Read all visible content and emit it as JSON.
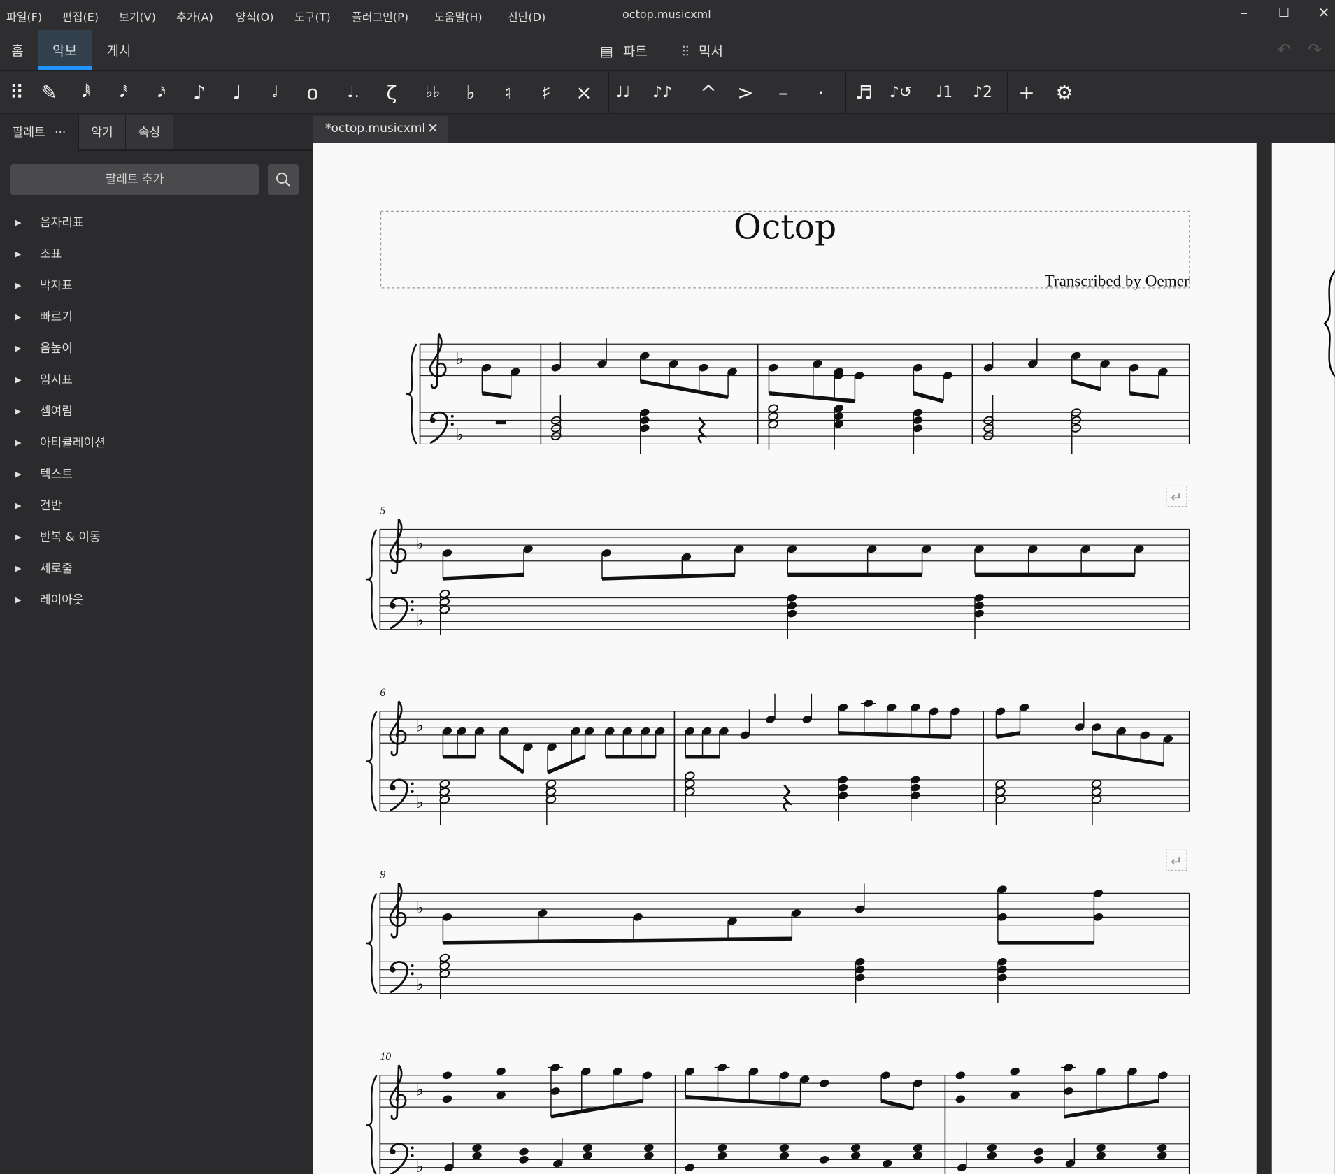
{
  "menu": [
    "파일(F)",
    "편집(E)",
    "보기(V)",
    "추가(A)",
    "양식(O)",
    "도구(T)",
    "플러그인(P)",
    "도움말(H)",
    "진단(D)"
  ],
  "window_title": "octop.musicxml",
  "window_controls": {
    "minimize": "–",
    "maximize": "☐",
    "close": "✕"
  },
  "main_tabs": [
    {
      "label": "홈"
    },
    {
      "label": "악보",
      "active": true
    },
    {
      "label": "게시"
    }
  ],
  "center_buttons": {
    "parts": "파트",
    "mixer": "믹서"
  },
  "toolbar": [
    {
      "name": "drag-handle-icon",
      "glyph": "⠿"
    },
    {
      "name": "note-input-pencil-icon",
      "glyph": "✎"
    },
    {
      "name": "64th-note-icon",
      "glyph": "𝅘𝅥𝅱"
    },
    {
      "name": "32nd-note-icon",
      "glyph": "𝅘𝅥𝅰"
    },
    {
      "name": "16th-note-icon",
      "glyph": "𝅘𝅥𝅯"
    },
    {
      "name": "eighth-note-icon",
      "glyph": "♪"
    },
    {
      "name": "quarter-note-icon",
      "glyph": "♩"
    },
    {
      "name": "half-note-icon",
      "glyph": "𝅗𝅥"
    },
    {
      "name": "whole-note-icon",
      "glyph": "o"
    },
    {
      "name": "augmentation-dot-icon",
      "glyph": "♩."
    },
    {
      "name": "rest-icon",
      "glyph": "ζ"
    },
    {
      "name": "double-flat-icon",
      "glyph": "♭♭"
    },
    {
      "name": "flat-icon",
      "glyph": "♭"
    },
    {
      "name": "natural-icon",
      "glyph": "♮"
    },
    {
      "name": "sharp-icon",
      "glyph": "♯"
    },
    {
      "name": "double-sharp-icon",
      "glyph": "×"
    },
    {
      "name": "tie-icon",
      "glyph": "♩♩"
    },
    {
      "name": "slur-icon",
      "glyph": "♪♪"
    },
    {
      "name": "marcato-icon",
      "glyph": "^"
    },
    {
      "name": "accent-icon",
      "glyph": ">"
    },
    {
      "name": "tenuto-icon",
      "glyph": "–"
    },
    {
      "name": "staccato-icon",
      "glyph": "·"
    },
    {
      "name": "tuplet-icon",
      "glyph": "♬"
    },
    {
      "name": "flip-direction-icon",
      "glyph": "♪↺"
    },
    {
      "name": "voice-1-icon",
      "glyph": "♩1"
    },
    {
      "name": "voice-2-icon",
      "glyph": "♪2"
    },
    {
      "name": "add-icon",
      "glyph": "+"
    },
    {
      "name": "settings-gear-icon",
      "glyph": "⚙"
    }
  ],
  "panel_tabs": {
    "palettes": "팔레트",
    "more": "···",
    "instruments": "악기",
    "properties": "속성"
  },
  "add_palette_label": "팔레트 추가",
  "palettes": [
    "음자리표",
    "조표",
    "박자표",
    "빠르기",
    "음높이",
    "임시표",
    "셈여림",
    "아티큘레이션",
    "텍스트",
    "건반",
    "반복 & 이동",
    "세로줄",
    "레이아웃"
  ],
  "document_tab": {
    "label": "*octop.musicxml",
    "close": "✕"
  },
  "score": {
    "title": "Octop",
    "composer": "Transcribed by Oemer",
    "measure_numbers": [
      "5",
      "6",
      "9",
      "10"
    ],
    "key_signature": "♭"
  }
}
